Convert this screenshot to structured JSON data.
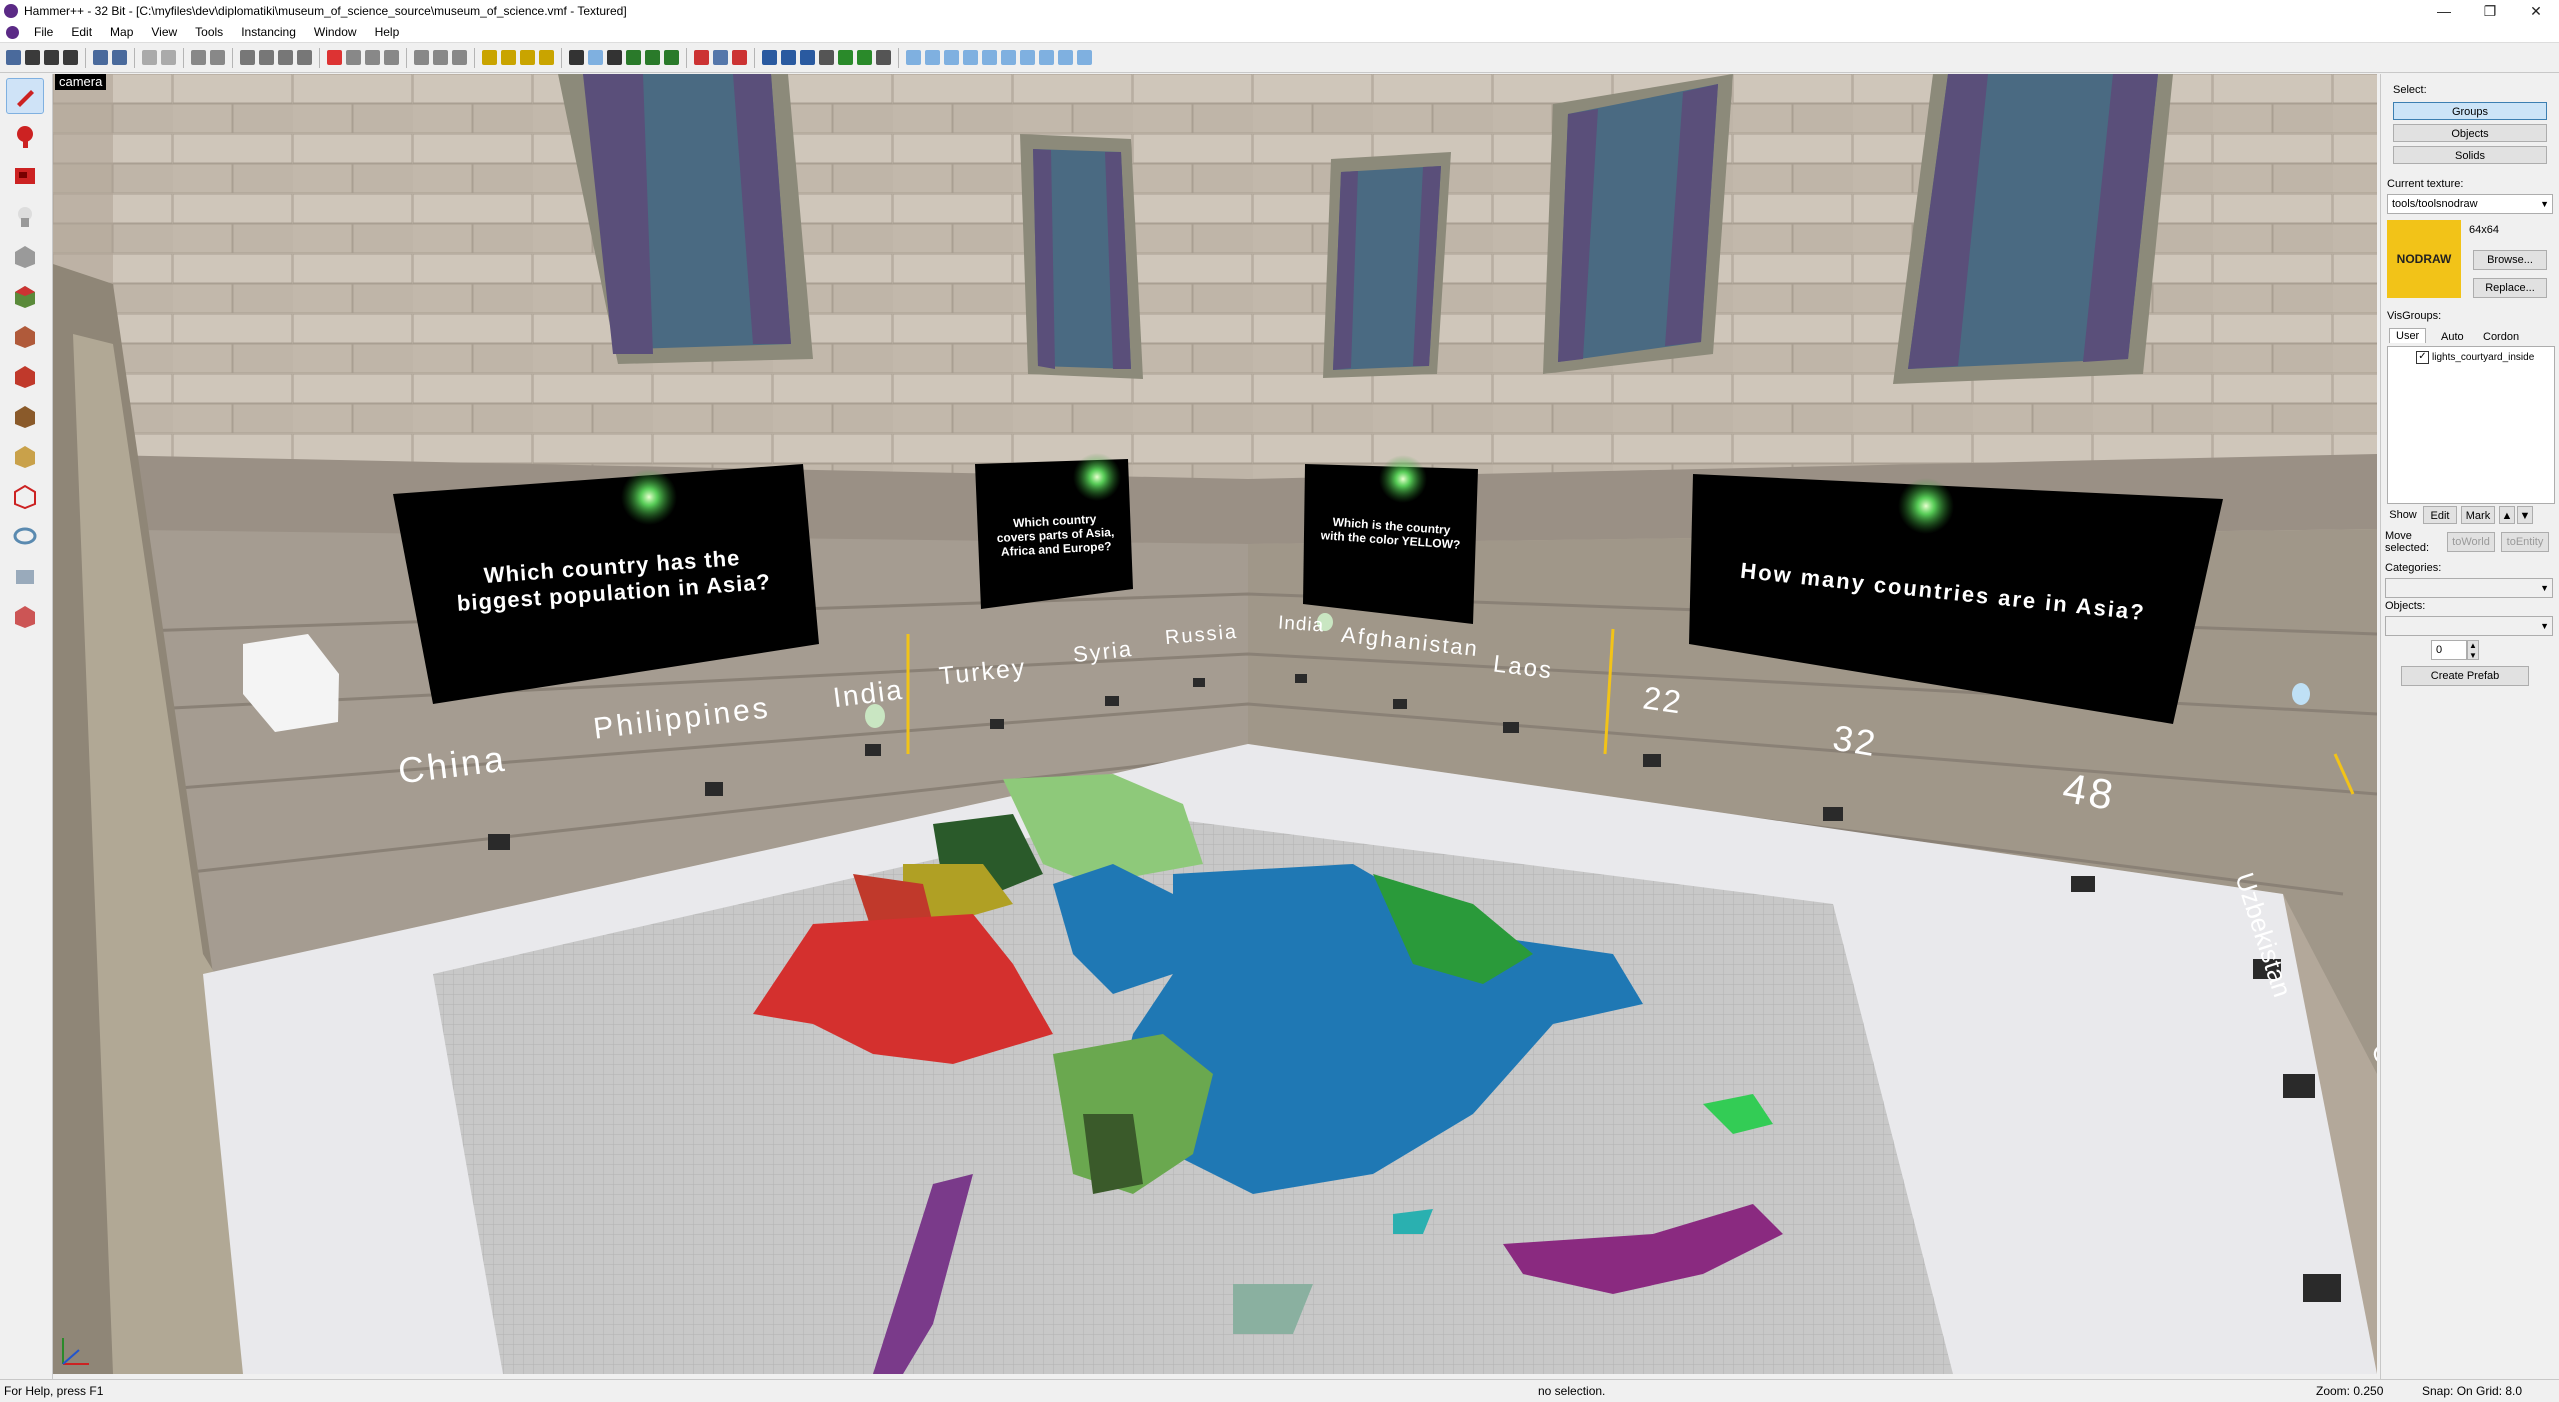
{
  "window": {
    "title": "Hammer++ - 32 Bit - [C:\\myfiles\\dev\\diplomatiki\\museum_of_science_source\\museum_of_science.vmf - Textured]",
    "minimize": "—",
    "maximize": "❐",
    "close": "✕"
  },
  "menu": [
    "File",
    "Edit",
    "Map",
    "View",
    "Tools",
    "Instancing",
    "Window",
    "Help"
  ],
  "viewport": {
    "label": "camera",
    "panels": [
      {
        "question": "Which country has the biggest population in Asia?"
      },
      {
        "question": "Which country covers parts of Asia, Africa and Europe?"
      },
      {
        "question": "Which is the country with the color YELLOW?"
      },
      {
        "question": "How many countries are in Asia?"
      }
    ],
    "answers_1": [
      "China",
      "Philippines",
      "India"
    ],
    "answers_2": [
      "Turkey",
      "Syria",
      "Russia"
    ],
    "answers_3": [
      "India",
      "Afghanistan",
      "Laos"
    ],
    "answers_4": [
      "22",
      "32",
      "48"
    ],
    "answers_side": [
      "Uzbekistan",
      "China"
    ]
  },
  "right_panel": {
    "select_label": "Select:",
    "select_buttons": [
      "Groups",
      "Objects",
      "Solids"
    ],
    "current_texture_label": "Current texture:",
    "current_texture": "tools/toolsnodraw",
    "texture_preview_text": "NODRAW",
    "texture_size": "64x64",
    "browse": "Browse...",
    "replace": "Replace...",
    "visgroups_label": "VisGroups:",
    "visgroup_tabs": [
      "User",
      "Auto",
      "Cordon"
    ],
    "visgroup_item": "lights_courtyard_inside",
    "show": "Show",
    "edit": "Edit",
    "mark": "Mark",
    "move_selected_label": "Move selected:",
    "to_world": "toWorld",
    "to_entity": "toEntity",
    "categories_label": "Categories:",
    "objects_label": "Objects:",
    "objects_count": "0",
    "create_prefab": "Create Prefab"
  },
  "status": {
    "help": "For Help, press F1",
    "selection": "no selection.",
    "zoom": "Zoom: 0.250",
    "snap": "Snap: On Grid: 8.0"
  },
  "colors": {
    "accent": "#5b2a86",
    "nodraw_yellow": "#f2c318",
    "selected_button": "#cce4f7"
  }
}
